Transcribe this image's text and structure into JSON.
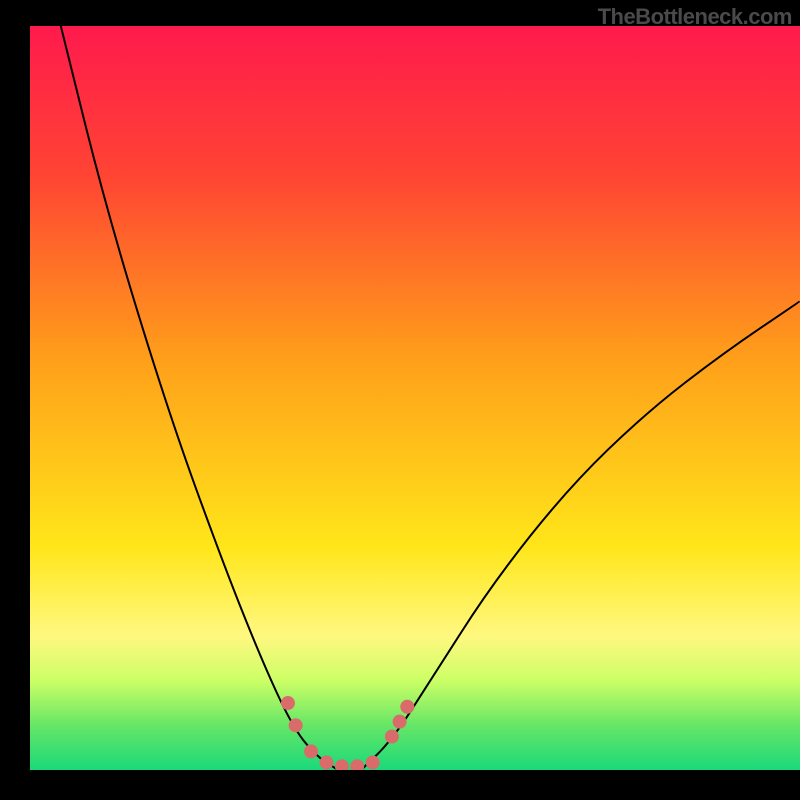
{
  "watermark": "TheBottleneck.com",
  "chart_data": {
    "type": "line",
    "title": "",
    "xlabel": "",
    "ylabel": "",
    "xlim": [
      0,
      100
    ],
    "ylim": [
      0,
      100
    ],
    "gradient_stops": [
      {
        "offset": 0,
        "color": "#ff1a4d"
      },
      {
        "offset": 20,
        "color": "#ff4433"
      },
      {
        "offset": 45,
        "color": "#ffa01a"
      },
      {
        "offset": 70,
        "color": "#ffe61a"
      },
      {
        "offset": 82,
        "color": "#fff880"
      },
      {
        "offset": 88,
        "color": "#ccff66"
      },
      {
        "offset": 94,
        "color": "#66e666"
      },
      {
        "offset": 100,
        "color": "#1ad97a"
      }
    ],
    "series": [
      {
        "name": "left-curve",
        "type": "curve",
        "data": [
          {
            "x": 4,
            "y": 100
          },
          {
            "x": 10,
            "y": 75
          },
          {
            "x": 18,
            "y": 48
          },
          {
            "x": 25,
            "y": 28
          },
          {
            "x": 30,
            "y": 15
          },
          {
            "x": 34,
            "y": 6
          },
          {
            "x": 37,
            "y": 2
          },
          {
            "x": 40,
            "y": 0
          }
        ]
      },
      {
        "name": "right-curve",
        "type": "curve",
        "data": [
          {
            "x": 43,
            "y": 0
          },
          {
            "x": 47,
            "y": 4
          },
          {
            "x": 52,
            "y": 12
          },
          {
            "x": 60,
            "y": 25
          },
          {
            "x": 70,
            "y": 38
          },
          {
            "x": 80,
            "y": 48
          },
          {
            "x": 90,
            "y": 56
          },
          {
            "x": 100,
            "y": 63
          }
        ]
      },
      {
        "name": "dots",
        "type": "scatter",
        "color": "#d96b6b",
        "radius": 7,
        "data": [
          {
            "x": 33.5,
            "y": 9.0
          },
          {
            "x": 34.5,
            "y": 6.0
          },
          {
            "x": 36.5,
            "y": 2.5
          },
          {
            "x": 38.5,
            "y": 1.0
          },
          {
            "x": 40.5,
            "y": 0.5
          },
          {
            "x": 42.5,
            "y": 0.5
          },
          {
            "x": 44.5,
            "y": 1.0
          },
          {
            "x": 47.0,
            "y": 4.5
          },
          {
            "x": 48.0,
            "y": 6.5
          },
          {
            "x": 49.0,
            "y": 8.5
          }
        ]
      }
    ]
  }
}
